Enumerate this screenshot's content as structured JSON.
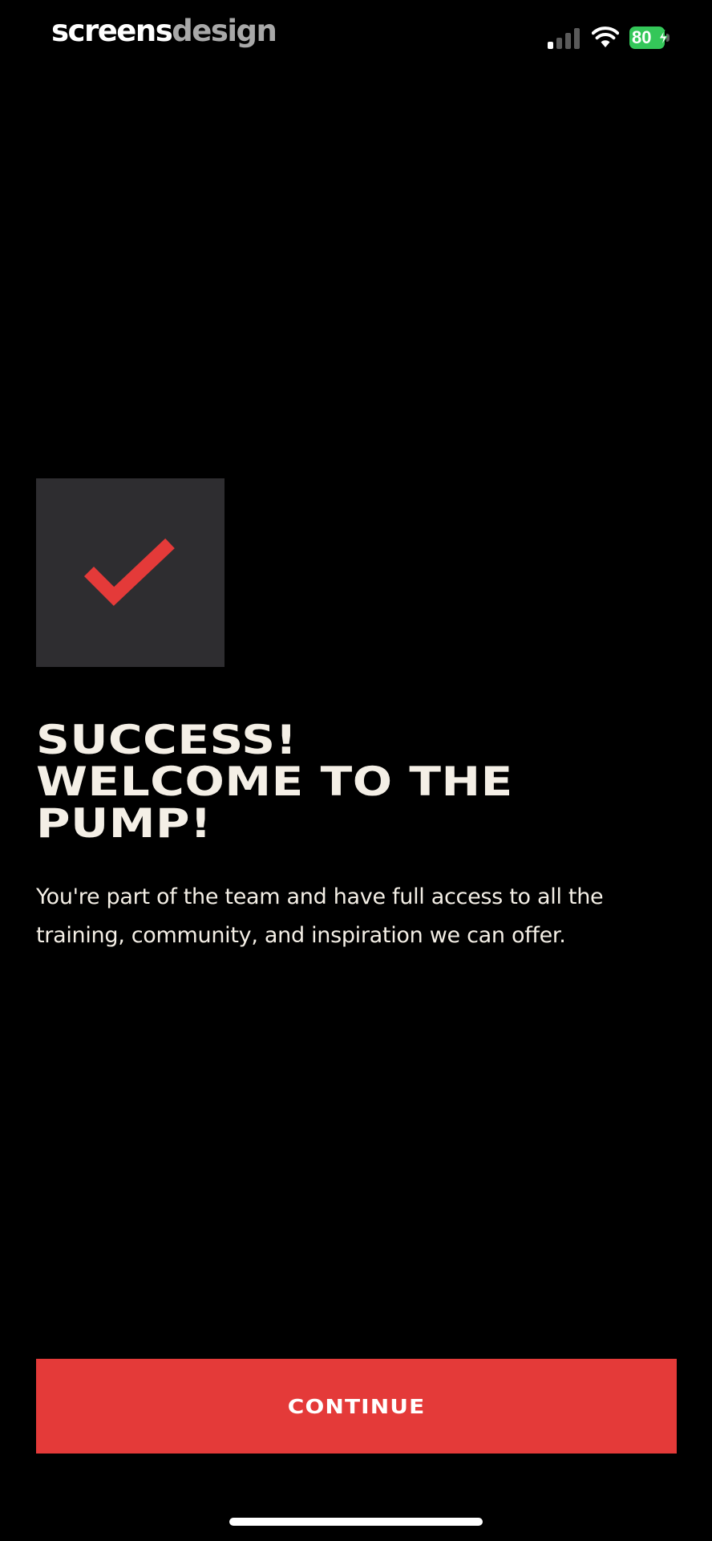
{
  "status_bar": {
    "brand_primary": "screens",
    "brand_secondary": "design",
    "battery_level": "80",
    "signal_bars_active": 1,
    "signal_bars_total": 4,
    "battery_color": "#34c759"
  },
  "badge": {
    "icon": "checkmark-icon",
    "check_color": "#e43a39",
    "background_color": "#2e2d30"
  },
  "headline": {
    "line1": "SUCCESS!",
    "line2": "WELCOME TO THE",
    "line3": "PUMP!"
  },
  "body": {
    "text": "You're part of the team and have full access to all the training, community, and inspiration we can offer."
  },
  "actions": {
    "continue_label": "CONTINUE",
    "button_color": "#e43a39"
  }
}
